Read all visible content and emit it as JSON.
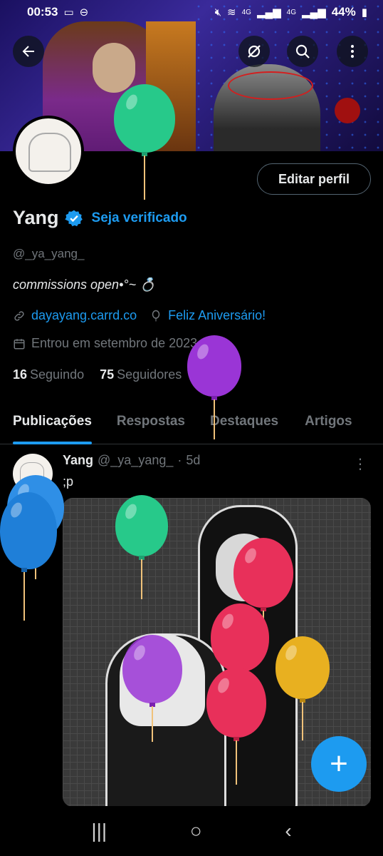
{
  "status_bar": {
    "time": "00:53",
    "battery": "44%",
    "signal_1": "4G",
    "signal_2": "4G"
  },
  "profile": {
    "display_name": "Yang",
    "verify_label": "Seja verificado",
    "handle": "@_ya_yang_",
    "bio": "commissions open•°~ 💍",
    "website": "dayayang.carrd.co",
    "birthday": "Feliz Aniversário!",
    "joined": "Entrou em setembro de 2023",
    "following_count": "16",
    "following_label": "Seguindo",
    "followers_count": "75",
    "followers_label": "Seguidores",
    "edit_button": "Editar perfil"
  },
  "tabs": [
    {
      "label": "Publicações",
      "active": true
    },
    {
      "label": "Respostas",
      "active": false
    },
    {
      "label": "Destaques",
      "active": false
    },
    {
      "label": "Artigos",
      "active": false
    }
  ],
  "post": {
    "author": "Yang",
    "handle": "@_ya_yang_",
    "separator": "·",
    "time": "5d",
    "text": ";p",
    "more": "⋮"
  },
  "fab_label": "+",
  "icons": {
    "back": "back-arrow-icon",
    "grok": "grok-icon",
    "search": "search-icon",
    "more": "more-vertical-icon",
    "link": "link-icon",
    "balloon": "balloon-icon",
    "calendar": "calendar-icon",
    "verified": "verified-badge-icon"
  },
  "colors": {
    "accent": "#1d9bf0",
    "muted": "#71767b",
    "text": "#e7e9ea",
    "background": "#000000"
  },
  "navigation": {
    "recents": "|||",
    "home": "○",
    "back": "‹"
  }
}
